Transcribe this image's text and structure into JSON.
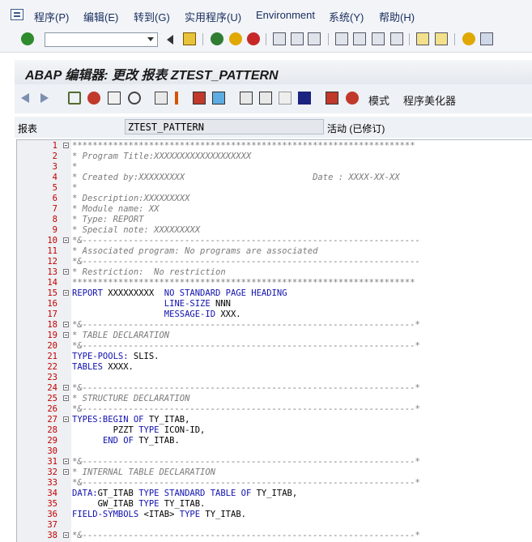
{
  "menu": {
    "items": [
      "程序(P)",
      "编辑(E)",
      "转到(G)",
      "实用程序(U)",
      "Environment",
      "系统(Y)",
      "帮助(H)"
    ]
  },
  "toolbar": {
    "command_field_value": "",
    "icons": [
      "enter-icon",
      "back-icon",
      "save-icon",
      "back-green-icon",
      "exit-icon",
      "cancel-icon",
      "print-icon",
      "find-icon",
      "find-next-icon",
      "first-page-icon",
      "prev-page-icon",
      "next-page-icon",
      "last-page-icon",
      "new-session-icon",
      "shortcut-icon",
      "help-icon",
      "layout-icon"
    ]
  },
  "screen": {
    "title": "ABAP 编辑器: 更改 报表 ZTEST_PATTERN"
  },
  "app_toolbar": {
    "pattern_label": "模式",
    "pretty_printer_label": "程序美化器"
  },
  "report_field": {
    "label": "报表",
    "value": "ZTEST_PATTERN",
    "status": "活动 (已修订)"
  },
  "editor": {
    "lines": [
      {
        "n": "1",
        "fold": true,
        "parts": [
          [
            "c",
            "*******************************************************************"
          ]
        ]
      },
      {
        "n": "2",
        "fold": false,
        "parts": [
          [
            "c",
            "* Program Title:XXXXXXXXXXXXXXXXXXX"
          ]
        ]
      },
      {
        "n": "3",
        "fold": false,
        "parts": [
          [
            "c",
            "*"
          ]
        ]
      },
      {
        "n": "4",
        "fold": false,
        "parts": [
          [
            "c",
            "* Created by:XXXXXXXXX                         Date : XXXX-XX-XX"
          ]
        ]
      },
      {
        "n": "5",
        "fold": false,
        "parts": [
          [
            "c",
            "*"
          ]
        ]
      },
      {
        "n": "6",
        "fold": false,
        "parts": [
          [
            "c",
            "* Description:XXXXXXXXX"
          ]
        ]
      },
      {
        "n": "7",
        "fold": false,
        "parts": [
          [
            "c",
            "* Module name: XX"
          ]
        ]
      },
      {
        "n": "8",
        "fold": false,
        "parts": [
          [
            "c",
            "* Type: REPORT"
          ]
        ]
      },
      {
        "n": "9",
        "fold": false,
        "parts": [
          [
            "c",
            "* Special note: XXXXXXXXX"
          ]
        ]
      },
      {
        "n": "10",
        "fold": true,
        "parts": [
          [
            "c",
            "*&------------------------------------------------------------------"
          ]
        ]
      },
      {
        "n": "11",
        "fold": false,
        "parts": [
          [
            "c",
            "* Associated program: No programs are associated"
          ]
        ]
      },
      {
        "n": "12",
        "fold": false,
        "parts": [
          [
            "c",
            "*&------------------------------------------------------------------"
          ]
        ]
      },
      {
        "n": "13",
        "fold": true,
        "parts": [
          [
            "c",
            "* Restriction:  No restriction"
          ]
        ]
      },
      {
        "n": "14",
        "fold": false,
        "parts": [
          [
            "c",
            "*******************************************************************"
          ]
        ]
      },
      {
        "n": "15",
        "fold": true,
        "parts": [
          [
            "k",
            "REPORT"
          ],
          [
            "p",
            " XXXXXXXXX  "
          ],
          [
            "k",
            "NO STANDARD PAGE HEADING"
          ]
        ]
      },
      {
        "n": "16",
        "fold": false,
        "parts": [
          [
            "p",
            "                  "
          ],
          [
            "k",
            "LINE-SIZE"
          ],
          [
            "p",
            " NNN"
          ]
        ]
      },
      {
        "n": "17",
        "fold": false,
        "parts": [
          [
            "p",
            "                  "
          ],
          [
            "k",
            "MESSAGE-ID"
          ],
          [
            "p",
            " XXX."
          ]
        ]
      },
      {
        "n": "18",
        "fold": true,
        "parts": [
          [
            "c",
            "*&-----------------------------------------------------------------*"
          ]
        ]
      },
      {
        "n": "19",
        "fold": true,
        "parts": [
          [
            "c",
            "* TABLE DECLARATION"
          ]
        ]
      },
      {
        "n": "20",
        "fold": false,
        "parts": [
          [
            "c",
            "*&-----------------------------------------------------------------*"
          ]
        ]
      },
      {
        "n": "21",
        "fold": false,
        "parts": [
          [
            "k",
            "TYPE-POOLS:"
          ],
          [
            "p",
            " SLIS."
          ]
        ]
      },
      {
        "n": "22",
        "fold": false,
        "parts": [
          [
            "k",
            "TABLES"
          ],
          [
            "p",
            " XXXX."
          ]
        ]
      },
      {
        "n": "23",
        "fold": false,
        "parts": [
          [
            "p",
            ""
          ]
        ]
      },
      {
        "n": "24",
        "fold": true,
        "parts": [
          [
            "c",
            "*&-----------------------------------------------------------------*"
          ]
        ]
      },
      {
        "n": "25",
        "fold": true,
        "parts": [
          [
            "c",
            "* STRUCTURE DECLARATION"
          ]
        ]
      },
      {
        "n": "26",
        "fold": false,
        "parts": [
          [
            "c",
            "*&-----------------------------------------------------------------*"
          ]
        ]
      },
      {
        "n": "27",
        "fold": true,
        "parts": [
          [
            "k",
            "TYPES:BEGIN OF"
          ],
          [
            "p",
            " TY_ITAB,"
          ]
        ]
      },
      {
        "n": "28",
        "fold": false,
        "parts": [
          [
            "p",
            "        PZZT "
          ],
          [
            "k",
            "TYPE"
          ],
          [
            "p",
            " ICON-ID,"
          ]
        ]
      },
      {
        "n": "29",
        "fold": false,
        "parts": [
          [
            "p",
            "      "
          ],
          [
            "k",
            "END OF"
          ],
          [
            "p",
            " TY_ITAB."
          ]
        ]
      },
      {
        "n": "30",
        "fold": false,
        "parts": [
          [
            "p",
            ""
          ]
        ]
      },
      {
        "n": "31",
        "fold": true,
        "parts": [
          [
            "c",
            "*&-----------------------------------------------------------------*"
          ]
        ]
      },
      {
        "n": "32",
        "fold": true,
        "parts": [
          [
            "c",
            "* INTERNAL TABLE DECLARATION"
          ]
        ]
      },
      {
        "n": "33",
        "fold": false,
        "parts": [
          [
            "c",
            "*&-----------------------------------------------------------------*"
          ]
        ]
      },
      {
        "n": "34",
        "fold": false,
        "parts": [
          [
            "k",
            "DATA:"
          ],
          [
            "p",
            "GT_ITAB "
          ],
          [
            "k",
            "TYPE STANDARD TABLE OF"
          ],
          [
            "p",
            " TY_ITAB,"
          ]
        ]
      },
      {
        "n": "35",
        "fold": false,
        "parts": [
          [
            "p",
            "     GW_ITAB "
          ],
          [
            "k",
            "TYPE"
          ],
          [
            "p",
            " TY_ITAB."
          ]
        ]
      },
      {
        "n": "36",
        "fold": false,
        "parts": [
          [
            "k",
            "FIELD-SYMBOLS"
          ],
          [
            "p",
            " <ITAB> "
          ],
          [
            "k",
            "TYPE"
          ],
          [
            "p",
            " TY_ITAB."
          ]
        ]
      },
      {
        "n": "37",
        "fold": false,
        "parts": [
          [
            "p",
            ""
          ]
        ]
      },
      {
        "n": "38",
        "fold": true,
        "parts": [
          [
            "c",
            "*&-----------------------------------------------------------------*"
          ]
        ]
      }
    ]
  }
}
